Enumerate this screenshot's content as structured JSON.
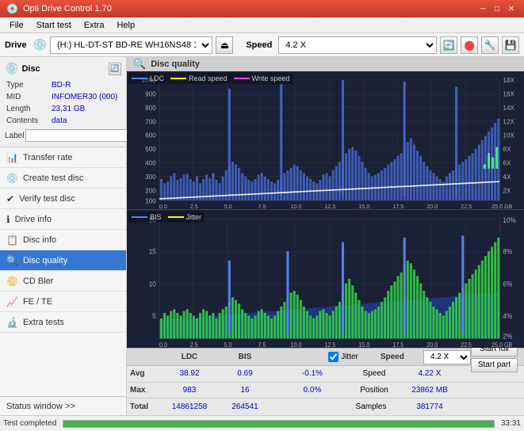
{
  "titlebar": {
    "title": "Opti Drive Control 1.70",
    "minimize": "─",
    "maximize": "□",
    "close": "✕"
  },
  "menubar": {
    "items": [
      "File",
      "Start test",
      "Extra",
      "Help"
    ]
  },
  "toolbar": {
    "drive_label": "Drive",
    "drive_value": "(H:) HL-DT-ST BD-RE  WH16NS48 1.D3",
    "speed_label": "Speed",
    "speed_value": "4.2 X"
  },
  "disc": {
    "title": "Disc",
    "type_label": "Type",
    "type_value": "BD-R",
    "mid_label": "MID",
    "mid_value": "INFOMER30 (000)",
    "length_label": "Length",
    "length_value": "23,31 GB",
    "contents_label": "Contents",
    "contents_value": "data",
    "label_label": "Label",
    "label_value": ""
  },
  "nav": {
    "items": [
      {
        "id": "transfer-rate",
        "label": "Transfer rate",
        "icon": "📊"
      },
      {
        "id": "create-test-disc",
        "label": "Create test disc",
        "icon": "💿"
      },
      {
        "id": "verify-test-disc",
        "label": "Verify test disc",
        "icon": "✔"
      },
      {
        "id": "drive-info",
        "label": "Drive info",
        "icon": "ℹ"
      },
      {
        "id": "disc-info",
        "label": "Disc info",
        "icon": "📋"
      },
      {
        "id": "disc-quality",
        "label": "Disc quality",
        "icon": "🔍",
        "active": true
      },
      {
        "id": "cd-bler",
        "label": "CD Bler",
        "icon": "📀"
      },
      {
        "id": "fe-te",
        "label": "FE / TE",
        "icon": "📈"
      },
      {
        "id": "extra-tests",
        "label": "Extra tests",
        "icon": "🔬"
      }
    ],
    "status_window": "Status window >>"
  },
  "chart": {
    "title": "Disc quality",
    "top": {
      "legend": [
        {
          "label": "LDC",
          "color": "#4488ff"
        },
        {
          "label": "Read speed",
          "color": "#ffff00"
        },
        {
          "label": "Write speed",
          "color": "#ff44ff"
        }
      ],
      "y_max": 1000,
      "y_labels": [
        "1000",
        "900",
        "800",
        "700",
        "600",
        "500",
        "400",
        "300",
        "200",
        "100"
      ],
      "y_right_labels": [
        "18X",
        "16X",
        "14X",
        "12X",
        "10X",
        "8X",
        "6X",
        "4X",
        "2X"
      ],
      "x_max": 25,
      "x_labels": [
        "0.0",
        "2.5",
        "5.0",
        "7.5",
        "10.0",
        "12.5",
        "15.0",
        "17.5",
        "20.0",
        "22.5",
        "25.0 GB"
      ]
    },
    "bottom": {
      "legend": [
        {
          "label": "BIS",
          "color": "#4488ff"
        },
        {
          "label": "Jitter",
          "color": "#ffff00"
        }
      ],
      "y_max": 20,
      "y_labels": [
        "20",
        "15",
        "10",
        "5"
      ],
      "y_right_labels": [
        "10%",
        "8%",
        "6%",
        "4%",
        "2%"
      ],
      "x_labels": [
        "0.0",
        "2.5",
        "5.0",
        "7.5",
        "10.0",
        "12.5",
        "15.0",
        "17.5",
        "20.0",
        "22.5",
        "25.0 GB"
      ]
    }
  },
  "stats": {
    "col_headers": [
      "LDC",
      "BIS",
      "",
      "Jitter",
      "Speed",
      ""
    ],
    "avg_label": "Avg",
    "avg_ldc": "38.92",
    "avg_bis": "0.69",
    "avg_jitter": "-0.1%",
    "avg_speed": "4.22 X",
    "speed_select": "4.2 X",
    "max_label": "Max",
    "max_ldc": "983",
    "max_bis": "16",
    "max_jitter": "0.0%",
    "max_pos_label": "Position",
    "max_pos_value": "23862 MB",
    "total_label": "Total",
    "total_ldc": "14861258",
    "total_bis": "264541",
    "total_samples_label": "Samples",
    "total_samples_value": "381774",
    "jitter_checked": true,
    "jitter_label": "Jitter",
    "start_full": "Start full",
    "start_part": "Start part"
  },
  "statusbar": {
    "status_text": "Test completed",
    "progress": 100,
    "time": "33:31"
  }
}
